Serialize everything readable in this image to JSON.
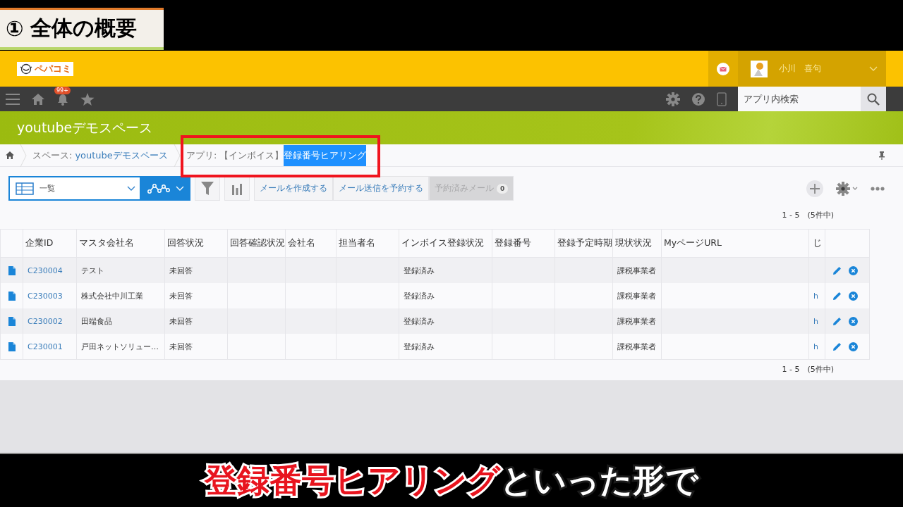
{
  "chapter": {
    "number": "①",
    "title": "全体の概要"
  },
  "header": {
    "logo": "ペパコミ",
    "user_name": "小川　喜句"
  },
  "nav": {
    "notification_badge": "99+",
    "search": {
      "placeholder": "アプリ内検索"
    }
  },
  "space_title": "youtubeデモスペース",
  "breadcrumb": {
    "space": {
      "label": "スペース:",
      "name": "youtubeデモスペース"
    },
    "app": {
      "label": "アプリ:",
      "highlighted": true,
      "parts": [
        {
          "text": "【インボイス】",
          "selected": false
        },
        {
          "text": "登録番号ヒアリング",
          "selected": true
        }
      ]
    }
  },
  "toolbar": {
    "view": "一覧",
    "buttons": [
      {
        "label": "メールを作成する",
        "disabled": false
      },
      {
        "label": "メール送信を予約する",
        "disabled": false
      },
      {
        "label": "予約済みメール",
        "disabled": true,
        "count": "0"
      }
    ]
  },
  "pager_top": "1 - 5　(5件中)",
  "table": {
    "columns": [
      {
        "label": "企業ID",
        "kind": "link"
      },
      {
        "label": "マスタ会社名",
        "kind": "text"
      },
      {
        "label": "回答状況",
        "kind": "text"
      },
      {
        "label": "回答確認状況"
      },
      {
        "label": "会社名"
      },
      {
        "label": "担当者名"
      },
      {
        "label": "インボイス登録状況",
        "kind": "text"
      },
      {
        "label": "登録番号"
      },
      {
        "label": "登録予定時期"
      },
      {
        "label": "現状状況",
        "kind": "text"
      },
      {
        "label": "MyページURL"
      },
      {
        "label": "じ",
        "kind": "link"
      }
    ],
    "rows": [
      {
        "cells": [
          "C230004",
          "テスト",
          "未回答",
          null,
          null,
          null,
          "登録済み",
          null,
          null,
          "課税事業者",
          null,
          null
        ]
      },
      {
        "cells": [
          "C230003",
          "株式会社中川工業",
          "未回答",
          null,
          null,
          null,
          "登録済み",
          null,
          null,
          "課税事業者",
          null,
          "h"
        ]
      },
      {
        "cells": [
          "C230002",
          "田端食品",
          "未回答",
          null,
          null,
          null,
          "登録済み",
          null,
          null,
          "課税事業者",
          null,
          "h"
        ]
      },
      {
        "cells": [
          "C230001",
          "戸田ネットソリュー…",
          "未回答",
          null,
          null,
          null,
          "登録済み",
          null,
          null,
          "課税事業者",
          null,
          "h"
        ]
      }
    ]
  },
  "pager_bottom": "1 - 5　(5件中)",
  "caption": [
    {
      "text": "登録番号ヒアリング",
      "emphasis": true
    },
    {
      "text": "といった形で",
      "emphasis": false
    }
  ]
}
